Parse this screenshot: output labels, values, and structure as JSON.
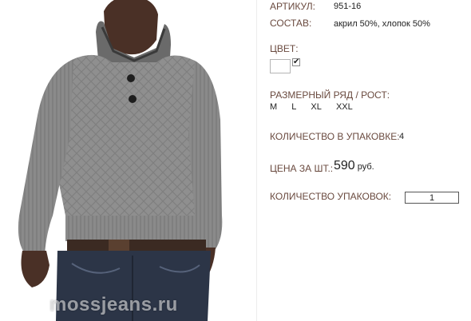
{
  "photo": {
    "watermark": "mossjeans.ru"
  },
  "details": {
    "article_label": "АРТИКУЛ:",
    "article_value": "951-16",
    "composition_label": "СОСТАВ:",
    "composition_value": "акрил 50%, хлопок 50%",
    "color_label": "ЦВЕТ:",
    "color_check": "✔",
    "size_label": "РАЗМЕРНЫЙ РЯД / РОСТ:",
    "sizes": [
      "M",
      "L",
      "XL",
      "XXL"
    ],
    "pack_qty_label": "КОЛИЧЕСТВО В УПАКОВКЕ:",
    "pack_qty_value": "4",
    "price_label": "ЦЕНА ЗА ШТ.:",
    "price_value": "590",
    "price_unit": "руб.",
    "packs_label": "КОЛИЧЕСТВО УПАКОВОК:",
    "packs_value": "1"
  },
  "colors": {
    "label": "#6a4a3f",
    "sweater": "#8f8f8f",
    "jeans": "#2c3547"
  }
}
